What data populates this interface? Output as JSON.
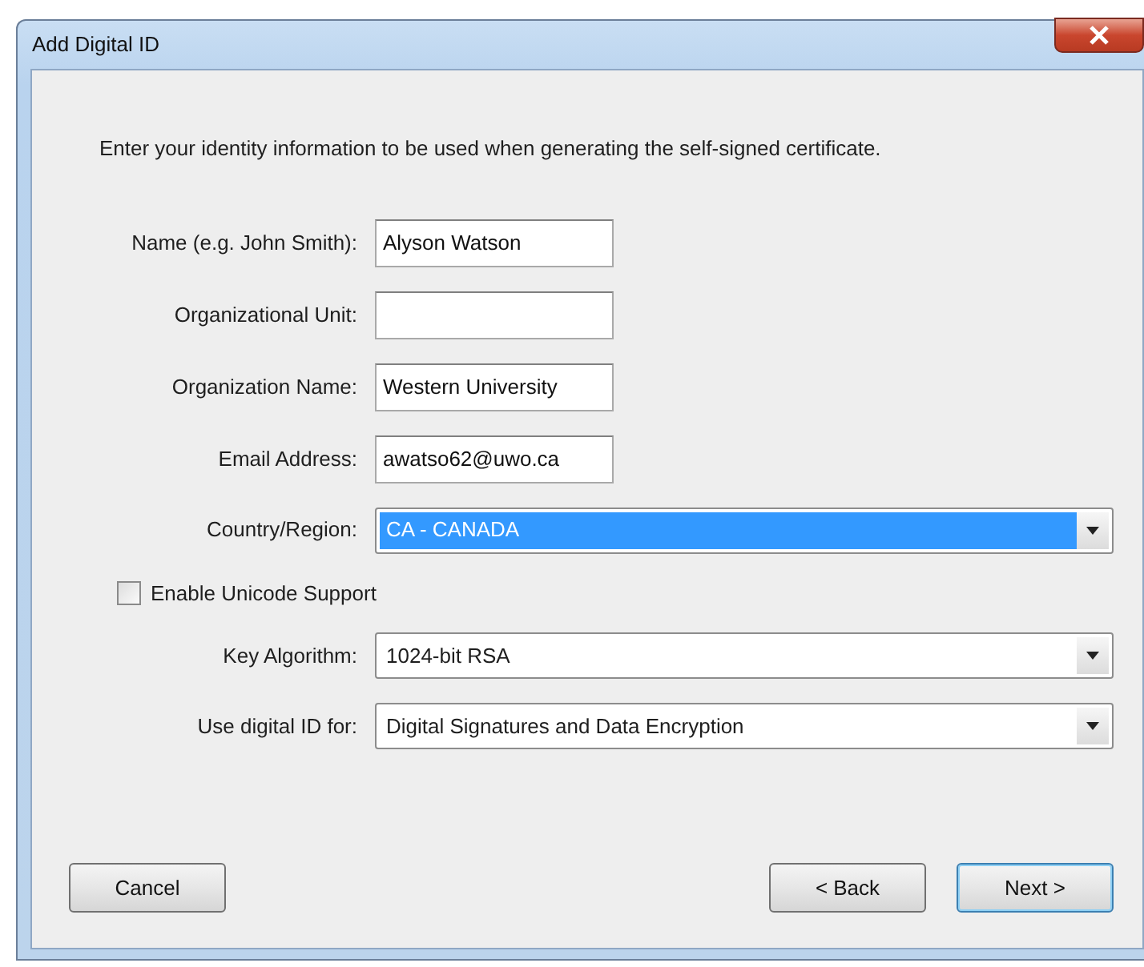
{
  "window": {
    "title": "Add Digital ID"
  },
  "intro": "Enter your identity information to be used when generating the self-signed certificate.",
  "fields": [
    {
      "kind": "text",
      "label": "Name (e.g. John Smith):",
      "value": "Alyson Watson"
    },
    {
      "kind": "text",
      "label": "Organizational Unit:"
    },
    {
      "kind": "text",
      "label": "Organization Name:",
      "value": "Western University"
    },
    {
      "kind": "text",
      "label": "Email Address:",
      "value": "awatso62@uwo.ca"
    },
    {
      "kind": "select",
      "label": "Country/Region:",
      "value": "CA - CANADA",
      "highlighted": true
    },
    {
      "kind": "checkbox",
      "label": "Enable Unicode Support",
      "checked": false
    },
    {
      "kind": "select",
      "label": "Key Algorithm:",
      "value": "1024-bit RSA",
      "highlighted": false
    },
    {
      "kind": "select",
      "label": "Use digital ID for:",
      "value": "Digital Signatures and Data Encryption",
      "highlighted": false
    }
  ],
  "buttons": [
    {
      "label": "Cancel",
      "default": false
    },
    {
      "label": "< Back",
      "default": false
    },
    {
      "label": "Next >",
      "default": true
    }
  ]
}
